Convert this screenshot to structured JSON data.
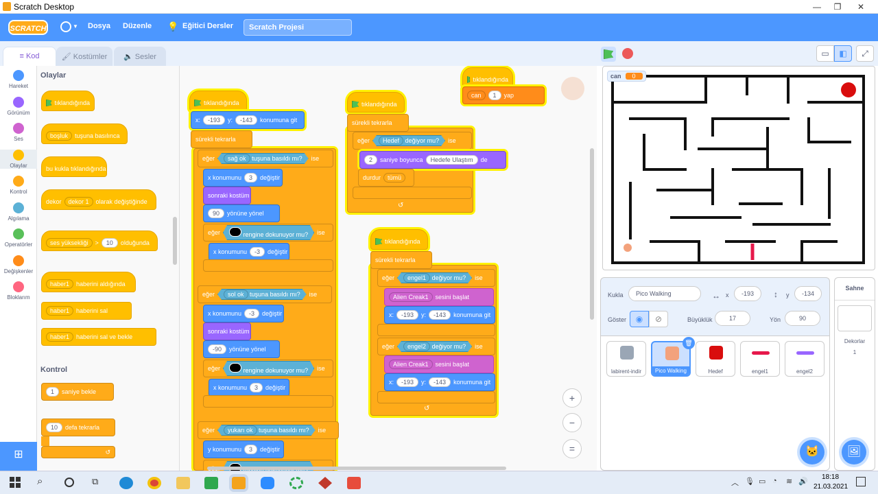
{
  "window": {
    "title": "Scratch Desktop",
    "min": "—",
    "max": "❐",
    "close": "✕"
  },
  "menubar": {
    "logo": "SCRATCH",
    "file": "Dosya",
    "edit": "Düzenle",
    "tutorials": "Eğitici Dersler",
    "project_title": "Scratch Projesi"
  },
  "tabs": {
    "code": "Kod",
    "costumes": "Kostümler",
    "sounds": "Sesler"
  },
  "categories": [
    {
      "label": "Hareket",
      "color": "#4c97ff"
    },
    {
      "label": "Görünüm",
      "color": "#9966ff"
    },
    {
      "label": "Ses",
      "color": "#cf63cf"
    },
    {
      "label": "Olaylar",
      "color": "#ffbf00"
    },
    {
      "label": "Kontrol",
      "color": "#ffab19"
    },
    {
      "label": "Algılama",
      "color": "#5cb1d6"
    },
    {
      "label": "Operatörler",
      "color": "#59c059"
    },
    {
      "label": "Değişkenler",
      "color": "#ff8c1a"
    },
    {
      "label": "Bloklarım",
      "color": "#ff6680"
    }
  ],
  "palette": {
    "events_heading": "Olaylar",
    "when_flag": "tıklandığında",
    "key_dd": "boşluk",
    "key_text": "tuşuna basılınca",
    "sprite_clicked": "bu kukla tıklandığında",
    "backdrop_pre": "dekor",
    "backdrop_dd": "dekor 1",
    "backdrop_post": "olarak değiştiğinde",
    "loud_dd": "ses yüksekliği",
    "gt": ">",
    "loud_val": "10",
    "loud_post": "olduğunda",
    "msg_dd": "haber1",
    "msg_recv": "haberini aldığında",
    "msg_send": "haberini sal",
    "msg_send_wait": "haberini sal ve bekle",
    "control_heading": "Kontrol",
    "wait_val": "1",
    "wait_text": "saniye bekle",
    "repeat_val": "10",
    "repeat_text": "defa tekrarla"
  },
  "script1": {
    "hat": "tıklandığında",
    "x_lbl": "x:",
    "x_val": "-193",
    "y_lbl": "y:",
    "y_val": "-143",
    "goto": "konumuna git",
    "forever": "sürekli tekrarla",
    "if": "eğer",
    "then": "ise",
    "right_key": "sağ ok",
    "left_key": "sol ok",
    "up_key": "yukarı ok",
    "pressed": "tuşuna basıldı mı?",
    "change_x": "x konumunu",
    "change_y": "y konumunu",
    "change": "değiştir",
    "v3": "3",
    "vn3": "-3",
    "next_costume": "sonraki kostüm",
    "d90": "90",
    "dn90": "-90",
    "point": "yönüne yönel",
    "touch_color": "rengine dokunuyor mu?"
  },
  "script2": {
    "hat": "tıklandığında",
    "forever": "sürekli tekrarla",
    "if": "eğer",
    "then": "ise",
    "target": "Hedef",
    "touching": "değiyor mu?",
    "secs": "2",
    "for_secs": "saniye boyunca",
    "msg": "Hedefe Ulaştım",
    "de": "de",
    "stop": "durdur",
    "stop_all": "tümü"
  },
  "script3": {
    "hat": "tıklandığında",
    "var": "can",
    "val": "1",
    "set": "yap"
  },
  "script4": {
    "hat": "tıklandığında",
    "forever": "sürekli tekrarla",
    "if": "eğer",
    "then": "ise",
    "touching": "değiyor mu?",
    "obs1": "engel1",
    "obs2": "engel2",
    "sound": "Alien Creak1",
    "play": "sesini başlat",
    "x_lbl": "x:",
    "x_val": "-193",
    "y_lbl": "y:",
    "y_val": "-143",
    "goto": "konumuna git"
  },
  "zoom": {
    "in": "+",
    "out": "−",
    "reset": "="
  },
  "stage": {
    "monitor_name": "can",
    "monitor_val": "0"
  },
  "sprite_info": {
    "sprite_lbl": "Kukla",
    "sprite_name": "Pico Walking",
    "x_lbl": "x",
    "x_val": "-193",
    "y_lbl": "y",
    "y_val": "-134",
    "show_lbl": "Göster",
    "size_lbl": "Büyüklük",
    "size_val": "17",
    "dir_lbl": "Yön",
    "dir_val": "90"
  },
  "sprites": [
    {
      "name": "labirent-indir"
    },
    {
      "name": "Pico Walking",
      "selected": true
    },
    {
      "name": "Hedef"
    },
    {
      "name": "engel1"
    },
    {
      "name": "engel2"
    }
  ],
  "stage_pane": {
    "title": "Sahne",
    "backdrops_lbl": "Dekorlar",
    "backdrops_count": "1"
  },
  "taskbar": {
    "time": "18:18",
    "date": "21.03.2021"
  }
}
